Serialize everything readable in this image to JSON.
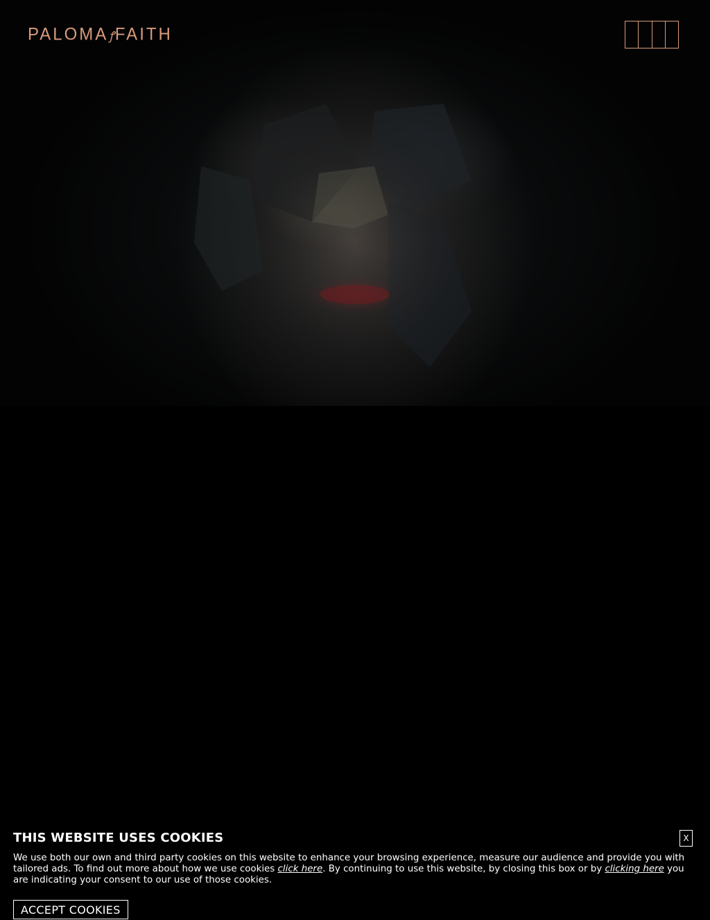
{
  "header": {
    "logo_left": "PALOMA",
    "logo_joiner": "ꝭ",
    "logo_right": "FAITH"
  },
  "colors": {
    "accent": "#d99b7c",
    "background": "#000000",
    "text": "#ffffff"
  },
  "menu": {
    "icon": "hamburger-vertical-bars-icon"
  },
  "cookie_banner": {
    "title": "THIS WEBSITE USES COOKIES",
    "text_part1": "We use both our own and third party cookies on this website to enhance your browsing experience, measure our audience and provide you with tailored ads. To find out more about how we use cookies ",
    "link1": "click here",
    "text_part2": ". By continuing to use this website, by closing this box or by ",
    "link2": "clicking here",
    "text_part3": " you are indicating your consent to our use of those cookies.",
    "close_label": "X",
    "accept_label": "ACCEPT COOKIES"
  }
}
